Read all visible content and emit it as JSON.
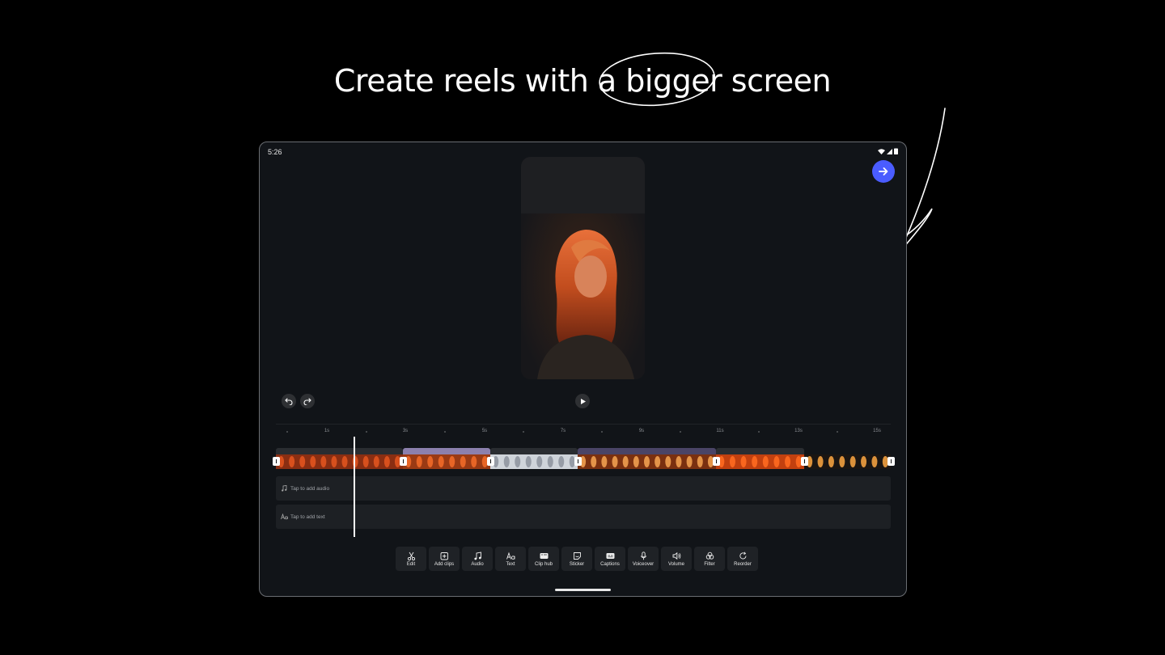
{
  "headline": "Create reels with a bigger screen",
  "status_bar": {
    "time": "5:26"
  },
  "timeline": {
    "ticks": [
      {
        "label": "1s"
      },
      {
        "label": "3s"
      },
      {
        "label": "5s"
      },
      {
        "label": "7s"
      },
      {
        "label": "9s"
      },
      {
        "label": "11s"
      },
      {
        "label": "13s"
      },
      {
        "label": "15s"
      }
    ],
    "audio_lane_label": "Tap to add audio",
    "text_lane_label": "Tap to add text"
  },
  "toolbar": {
    "items": [
      {
        "label": "Edit",
        "icon": "scissors-icon"
      },
      {
        "label": "Add clips",
        "icon": "add-clip-icon"
      },
      {
        "label": "Audio",
        "icon": "music-note-icon"
      },
      {
        "label": "Text",
        "icon": "text-aa-icon"
      },
      {
        "label": "Clip hub",
        "icon": "clip-hub-icon"
      },
      {
        "label": "Sticker",
        "icon": "sticker-icon"
      },
      {
        "label": "Captions",
        "icon": "captions-icon"
      },
      {
        "label": "Voiceover",
        "icon": "microphone-icon"
      },
      {
        "label": "Volume",
        "icon": "speaker-icon"
      },
      {
        "label": "Filter",
        "icon": "filter-icon"
      },
      {
        "label": "Reorder",
        "icon": "reorder-icon"
      }
    ]
  },
  "colors": {
    "accent": "#4a5cff",
    "device_bg": "#111418",
    "lane_bg": "#1d2024",
    "clip_band": "#6b5f8a",
    "clip_band_dark": "#3a3650"
  }
}
